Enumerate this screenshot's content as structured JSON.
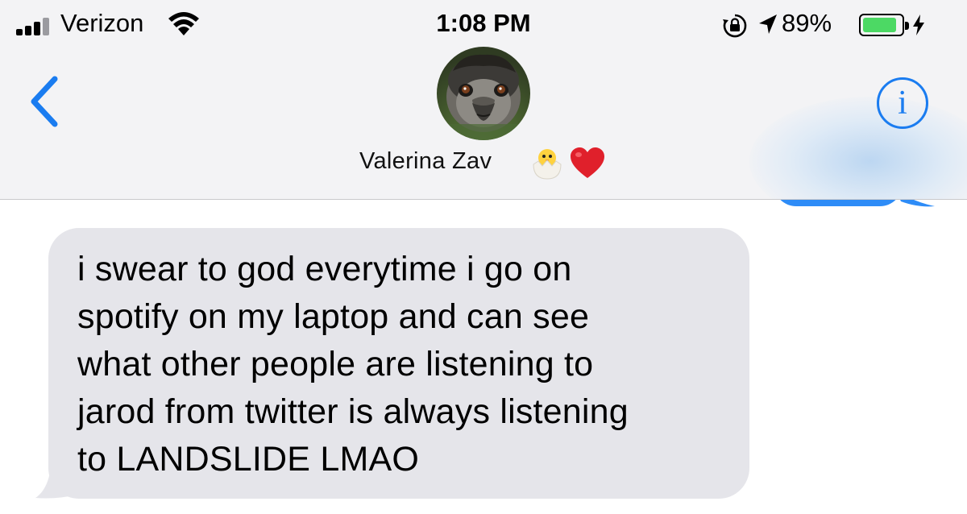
{
  "status_bar": {
    "carrier": "Verizon",
    "time": "1:08 PM",
    "battery_percent": "89%",
    "battery_level": 0.89,
    "icons": [
      "signal-icon",
      "wifi-icon",
      "orientation-lock-icon",
      "location-arrow-icon",
      "battery-icon",
      "charging-bolt-icon"
    ]
  },
  "header": {
    "back_icon": "chevron-left-icon",
    "contact_name": "Valerina Zav",
    "name_emojis": [
      "hatching-chick-emoji",
      "red-heart-emoji"
    ],
    "info_label": "i",
    "accent_color": "#1a7cf0"
  },
  "messages": [
    {
      "direction": "incoming",
      "text": "i swear to god everytime i go on\nspotify on my laptop and can see\nwhat other people are listening to\njarod from twitter is always listening\nto LANDSLIDE LMAO",
      "bubble_color": "#e5e5ea"
    }
  ],
  "colors": {
    "outgoing_bubble": "#2e8cf7",
    "incoming_bubble": "#e5e5ea",
    "battery_fill": "#4cd964"
  }
}
